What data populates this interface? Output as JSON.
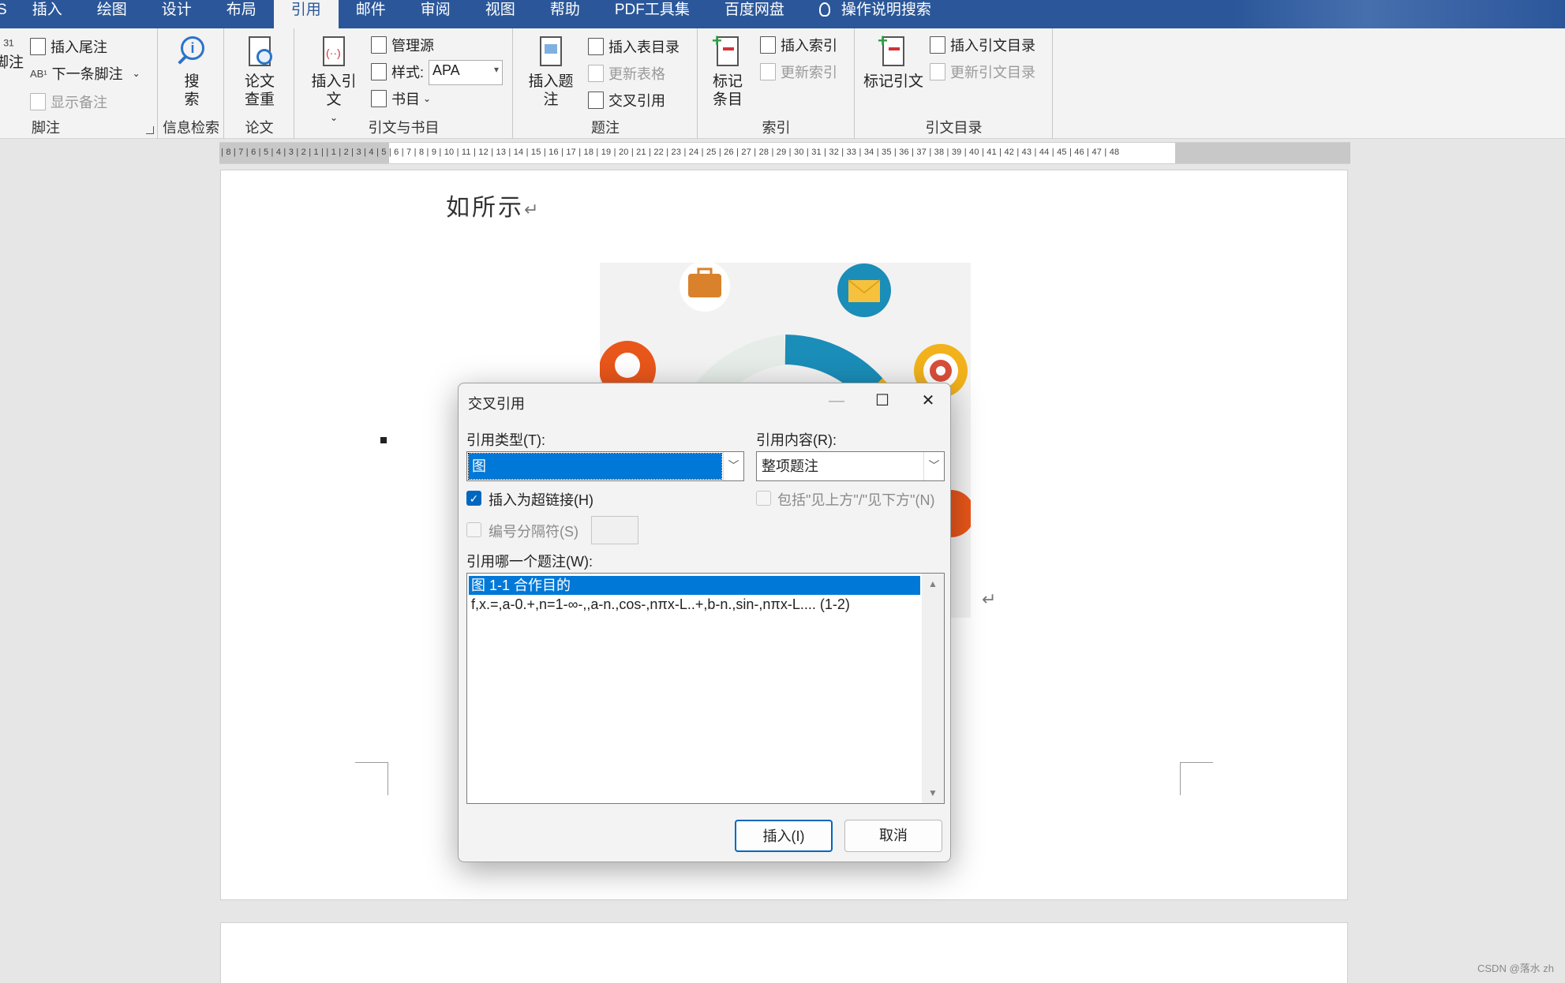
{
  "tabs": [
    {
      "label": "S",
      "active": false
    },
    {
      "label": "插入",
      "active": false
    },
    {
      "label": "绘图",
      "active": false
    },
    {
      "label": "设计",
      "active": false
    },
    {
      "label": "布局",
      "active": false
    },
    {
      "label": "引用",
      "active": true
    },
    {
      "label": "邮件",
      "active": false
    },
    {
      "label": "审阅",
      "active": false
    },
    {
      "label": "视图",
      "active": false
    },
    {
      "label": "帮助",
      "active": false
    },
    {
      "label": "PDF工具集",
      "active": false
    },
    {
      "label": "百度网盘",
      "active": false
    },
    {
      "label": "操作说明搜索",
      "active": false
    }
  ],
  "ribbon": {
    "footnote": {
      "group_label": "脚注",
      "footnote_btn": "脚注",
      "insert_endnote": "插入尾注",
      "next_footnote": "下一条脚注",
      "show_notes": "显示备注"
    },
    "research": {
      "group_label": "信息检索",
      "search_line1": "搜",
      "search_line2": "索"
    },
    "paper": {
      "group_label": "论文",
      "check_line1": "论文",
      "check_line2": "查重"
    },
    "citations": {
      "group_label": "引文与书目",
      "insert_citation": "插入引文",
      "manage_sources": "管理源",
      "style_label": "样式:",
      "style_value": "APA",
      "bibliography": "书目"
    },
    "captions": {
      "group_label": "题注",
      "insert_caption": "插入题注",
      "insert_table_of_figures": "插入表目录",
      "update_table": "更新表格",
      "cross_reference": "交叉引用"
    },
    "index": {
      "group_label": "索引",
      "mark_entry_line1": "标记",
      "mark_entry_line2": "条目",
      "insert_index": "插入索引",
      "update_index": "更新索引"
    },
    "toa": {
      "group_label": "引文目录",
      "mark_citation": "标记引文",
      "insert_toa": "插入引文目录",
      "update_toa": "更新引文目录"
    }
  },
  "ruler_text": "| 8 | 7 | 6 | 5 | 4 | 3 | 2 | 1 |   | 1 | 2 | 3 | 4 | 5 | 6 | 7 | 8 | 9 | 10 | 11 | 12 | 13 | 14 | 15 | 16 | 17 | 18 | 19 | 20 | 21 | 22 | 23 | 24 | 25 | 26 | 27 | 28 | 29 | 30 | 31 | 32 | 33 | 34 | 35 | 36 | 37 | 38 | 39 | 40 | 41 | 42 | 43 | 44 | 45 | 46 | 47 | 48",
  "document": {
    "text": "如所示",
    "paragraph_mark": "↵"
  },
  "dialog": {
    "title": "交叉引用",
    "ref_type_label": "引用类型(T):",
    "ref_type_value": "图",
    "ref_content_label": "引用内容(R):",
    "ref_content_value": "整项题注",
    "insert_hyperlink_label": "插入为超链接(H)",
    "insert_hyperlink_checked": true,
    "include_above_below_label": "包括\"见上方\"/\"见下方\"(N)",
    "number_separator_label": "编号分隔符(S)",
    "which_caption_label": "引用哪一个题注(W):",
    "captions": [
      "图 1-1 合作目的",
      "f,x.=,a-0.+,n=1-∞-,,a-n.,cos-,nπx-L..+,b-n.,sin-,nπx-L....  (1-2)"
    ],
    "insert_button": "插入(I)",
    "cancel_button": "取消",
    "minimize_glyph": "—",
    "maximize_glyph": "☐",
    "close_glyph": "✕"
  },
  "watermark": "CSDN @落水 zh",
  "colors": {
    "tab_bar": "#2b579a",
    "selection": "#0078d7",
    "checkbox_checked": "#0067c0"
  }
}
